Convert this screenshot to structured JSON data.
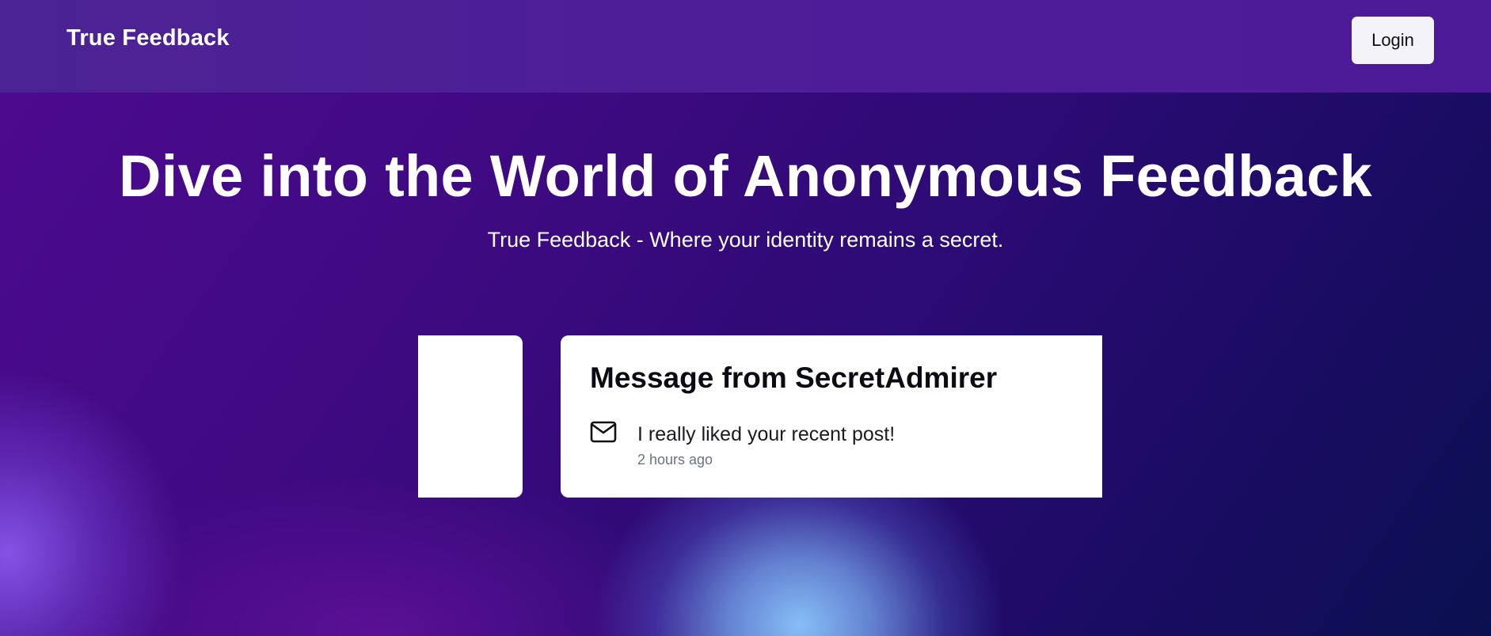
{
  "navbar": {
    "brand": "True Feedback",
    "login_label": "Login"
  },
  "hero": {
    "title": "Dive into the World of Anonymous Feedback",
    "subtitle": "True Feedback - Where your identity remains a secret."
  },
  "message_card": {
    "title": "Message from SecretAdmirer",
    "icon": "mail-icon",
    "content": "I really liked your recent post!",
    "time": "2 hours ago"
  },
  "colors": {
    "navbar": "#4d1f96",
    "background_start": "#4e0a91",
    "background_end": "#0a1150",
    "card": "#ffffff",
    "muted_text": "#6b7280"
  }
}
